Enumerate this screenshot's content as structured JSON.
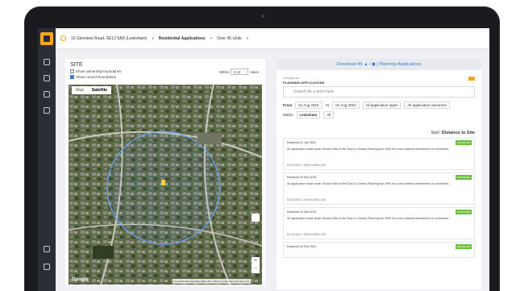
{
  "topbar": {
    "address": "15 Glenview Road, SE13 5AD (Lewisham)",
    "application_type": "Residential Applications",
    "units": "Over 45 Units"
  },
  "site": {
    "title": "SITE",
    "show_ownership": "Show ownership boundaries",
    "show_council": "Show council boundaries",
    "within_label": "Within",
    "within_value": "0.12",
    "within_unit": "miles"
  },
  "map": {
    "tab_map": "Map",
    "tab_satellite": "Satellite",
    "google": "Google",
    "attribution": "Keyboard shortcuts  Map Data  100 m  Terms of Use  Report a map error",
    "zoom_in": "+",
    "zoom_out": "−"
  },
  "planning": {
    "download": "Download 45 ▲ / ◼ | Planning Applications",
    "count_label": "118 approval",
    "title": "PLANNING APPLICATIONS",
    "search_placeholder": "Search for a term here",
    "from_label": "From",
    "from_date": "01 Aug 2015",
    "to_label": "To",
    "to_date": "01 Aug 2021",
    "types": "All application types",
    "outcomes": "All application outcomes",
    "within_label": "Within",
    "within_value": "Lewisham",
    "all_label": "All",
    "sort_prefix": "Sort:",
    "sort_value": "Distance to Site",
    "cards": [
      {
        "received": "Received 01 Jan 2021",
        "badge": "APPROVED",
        "description": "An application made under Section 96a of the Town & Country Planning Act 1990 for a non-material amendment in connection...",
        "meta": "DECISION   1 NEW DWELLING"
      },
      {
        "received": "Received 10 Nov 2019",
        "badge": "APPROVED",
        "description": "An application made under Section 96a of the Town & Country Planning Act 1990 for a non-material amendment in connection...",
        "meta": "DECISION   1 NEW DWELLING"
      },
      {
        "received": "Received 10 Dec 2019",
        "badge": "APPROVED",
        "description": "An application made under Section 96a of the Town & Country Planning Act 1990 for a non-material amendment in connection...",
        "meta": "DECISION   1 NEW DWELLING"
      },
      {
        "received": "Received 10 Feb 2021",
        "badge": "APPROVED",
        "description": "",
        "meta": ""
      }
    ]
  }
}
